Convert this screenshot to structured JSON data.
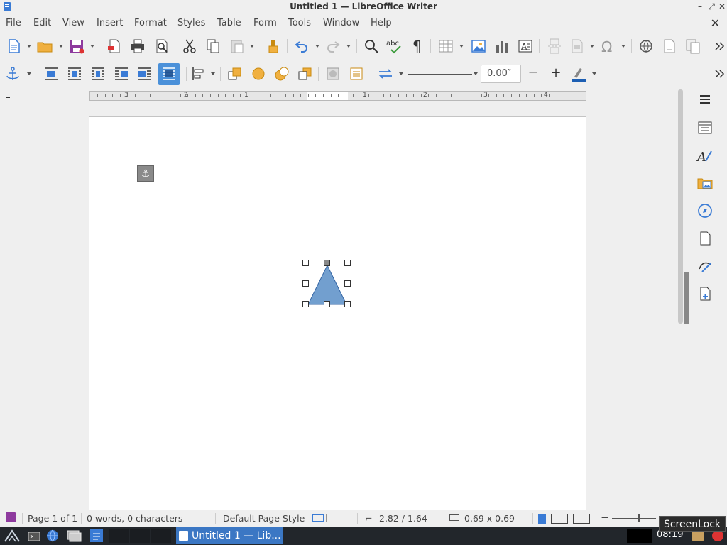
{
  "window": {
    "title": "Untitled 1 — LibreOffice Writer"
  },
  "menu": [
    "File",
    "Edit",
    "View",
    "Insert",
    "Format",
    "Styles",
    "Table",
    "Form",
    "Tools",
    "Window",
    "Help"
  ],
  "toolbar1": {
    "icons": [
      "new-document-icon",
      "open-folder-icon",
      "save-icon",
      "export-pdf-icon",
      "print-icon",
      "print-preview-icon",
      "cut-icon",
      "copy-icon",
      "paste-icon",
      "clone-formatting-icon",
      "undo-icon",
      "redo-icon",
      "find-replace-icon",
      "spelling-icon",
      "formatting-marks-icon",
      "insert-table-icon",
      "insert-image-icon",
      "insert-chart-icon",
      "insert-text-box-icon",
      "insert-page-break-icon",
      "insert-field-icon",
      "special-character-icon",
      "hyperlink-icon",
      "footnote-icon",
      "comment-icon",
      "more-icon"
    ]
  },
  "toolbar2": {
    "line_width_value": "0.00″",
    "line_color": "#1d5fb3",
    "icons": [
      "anchor-icon",
      "wrap-off-icon",
      "wrap-page-icon",
      "wrap-ideal-icon",
      "wrap-left-icon",
      "wrap-right-icon",
      "wrap-through-icon",
      "align-objects-icon",
      "bring-to-front-icon",
      "forward-one-icon",
      "backward-one-icon",
      "send-to-back-icon",
      "to-background-icon",
      "to-foreground-icon",
      "arrow-style-icon",
      "line-style-icon",
      "decrease-icon",
      "increase-icon",
      "line-color-icon",
      "more-icon"
    ]
  },
  "ruler": {
    "left_numbers": [
      "3",
      "2",
      "1"
    ],
    "right_numbers": [
      "1",
      "2",
      "3",
      "4"
    ]
  },
  "document": {
    "shape": {
      "type": "triangle",
      "fill": "#729fcf",
      "stroke": "#3465a4"
    }
  },
  "sidebar": {
    "icons": [
      "menu-icon",
      "properties-icon",
      "styles-icon",
      "gallery-icon",
      "navigator-icon",
      "page-icon",
      "manage-changes-icon",
      "design-icon"
    ]
  },
  "status": {
    "page": "Page 1 of 1",
    "words": "0 words, 0 characters",
    "page_style": "Default Page Style",
    "position": "2.82 / 1.64",
    "size": "0.69 x 0.69"
  },
  "taskbar": {
    "task_label": "Untitled 1 — Lib...",
    "clock": "08:19",
    "tooltip": "ScreenLock"
  },
  "colors": {
    "accent": "#4a90d9",
    "shape_fill": "#729fcf",
    "taskbar_bg": "#22262b"
  }
}
